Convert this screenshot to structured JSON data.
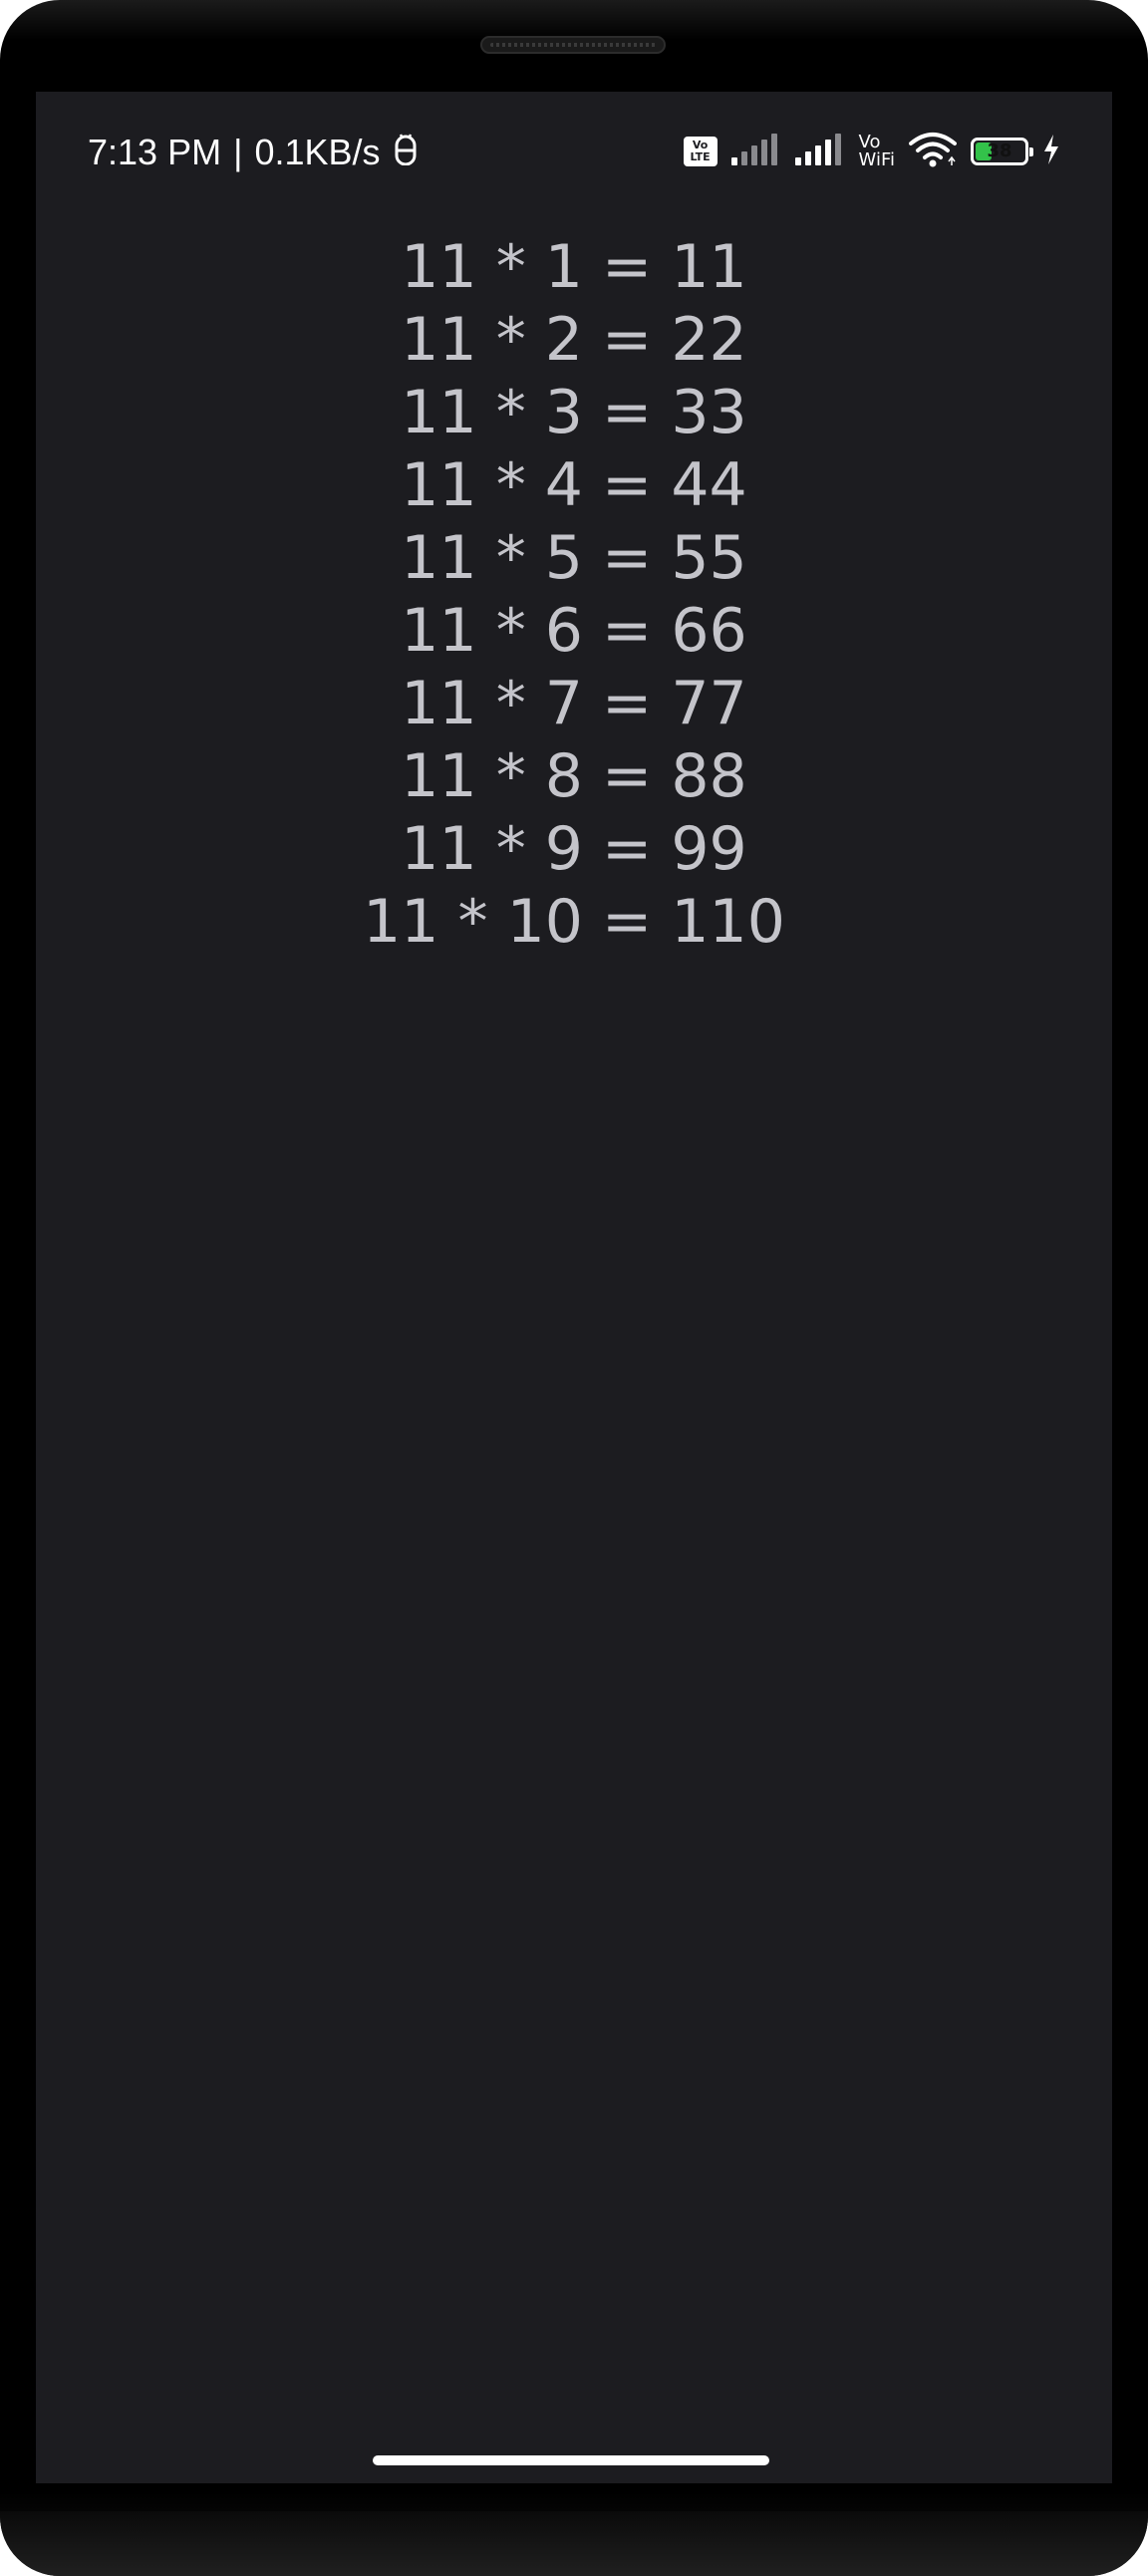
{
  "status_bar": {
    "time": "7:13 PM",
    "separator": "|",
    "net_speed": "0.1KB/s",
    "volte_top": "Vo",
    "volte_bottom": "LTE",
    "vowifi_top": "Vo",
    "vowifi_bottom": "WiFi",
    "battery_level": "38",
    "battery_fraction": 0.38,
    "battery_color": "#33c24a",
    "icons": [
      "android-debug-icon",
      "volte-icon",
      "signal-sim1-icon",
      "signal-sim2-icon",
      "vowifi-icon",
      "wifi-icon",
      "battery-icon",
      "charging-bolt-icon"
    ]
  },
  "multiplication_table": {
    "rows": [
      "11 * 1 = 11",
      "11 * 2 = 22",
      "11 * 3 = 33",
      "11 * 4 = 44",
      "11 * 5 = 55",
      "11 * 6 = 66",
      "11 * 7 = 77",
      "11 * 8 = 88",
      "11 * 9 = 99",
      "11 * 10 = 110"
    ]
  },
  "colors": {
    "screen_background": "#1c1c20",
    "text": "#c4c4ca"
  }
}
